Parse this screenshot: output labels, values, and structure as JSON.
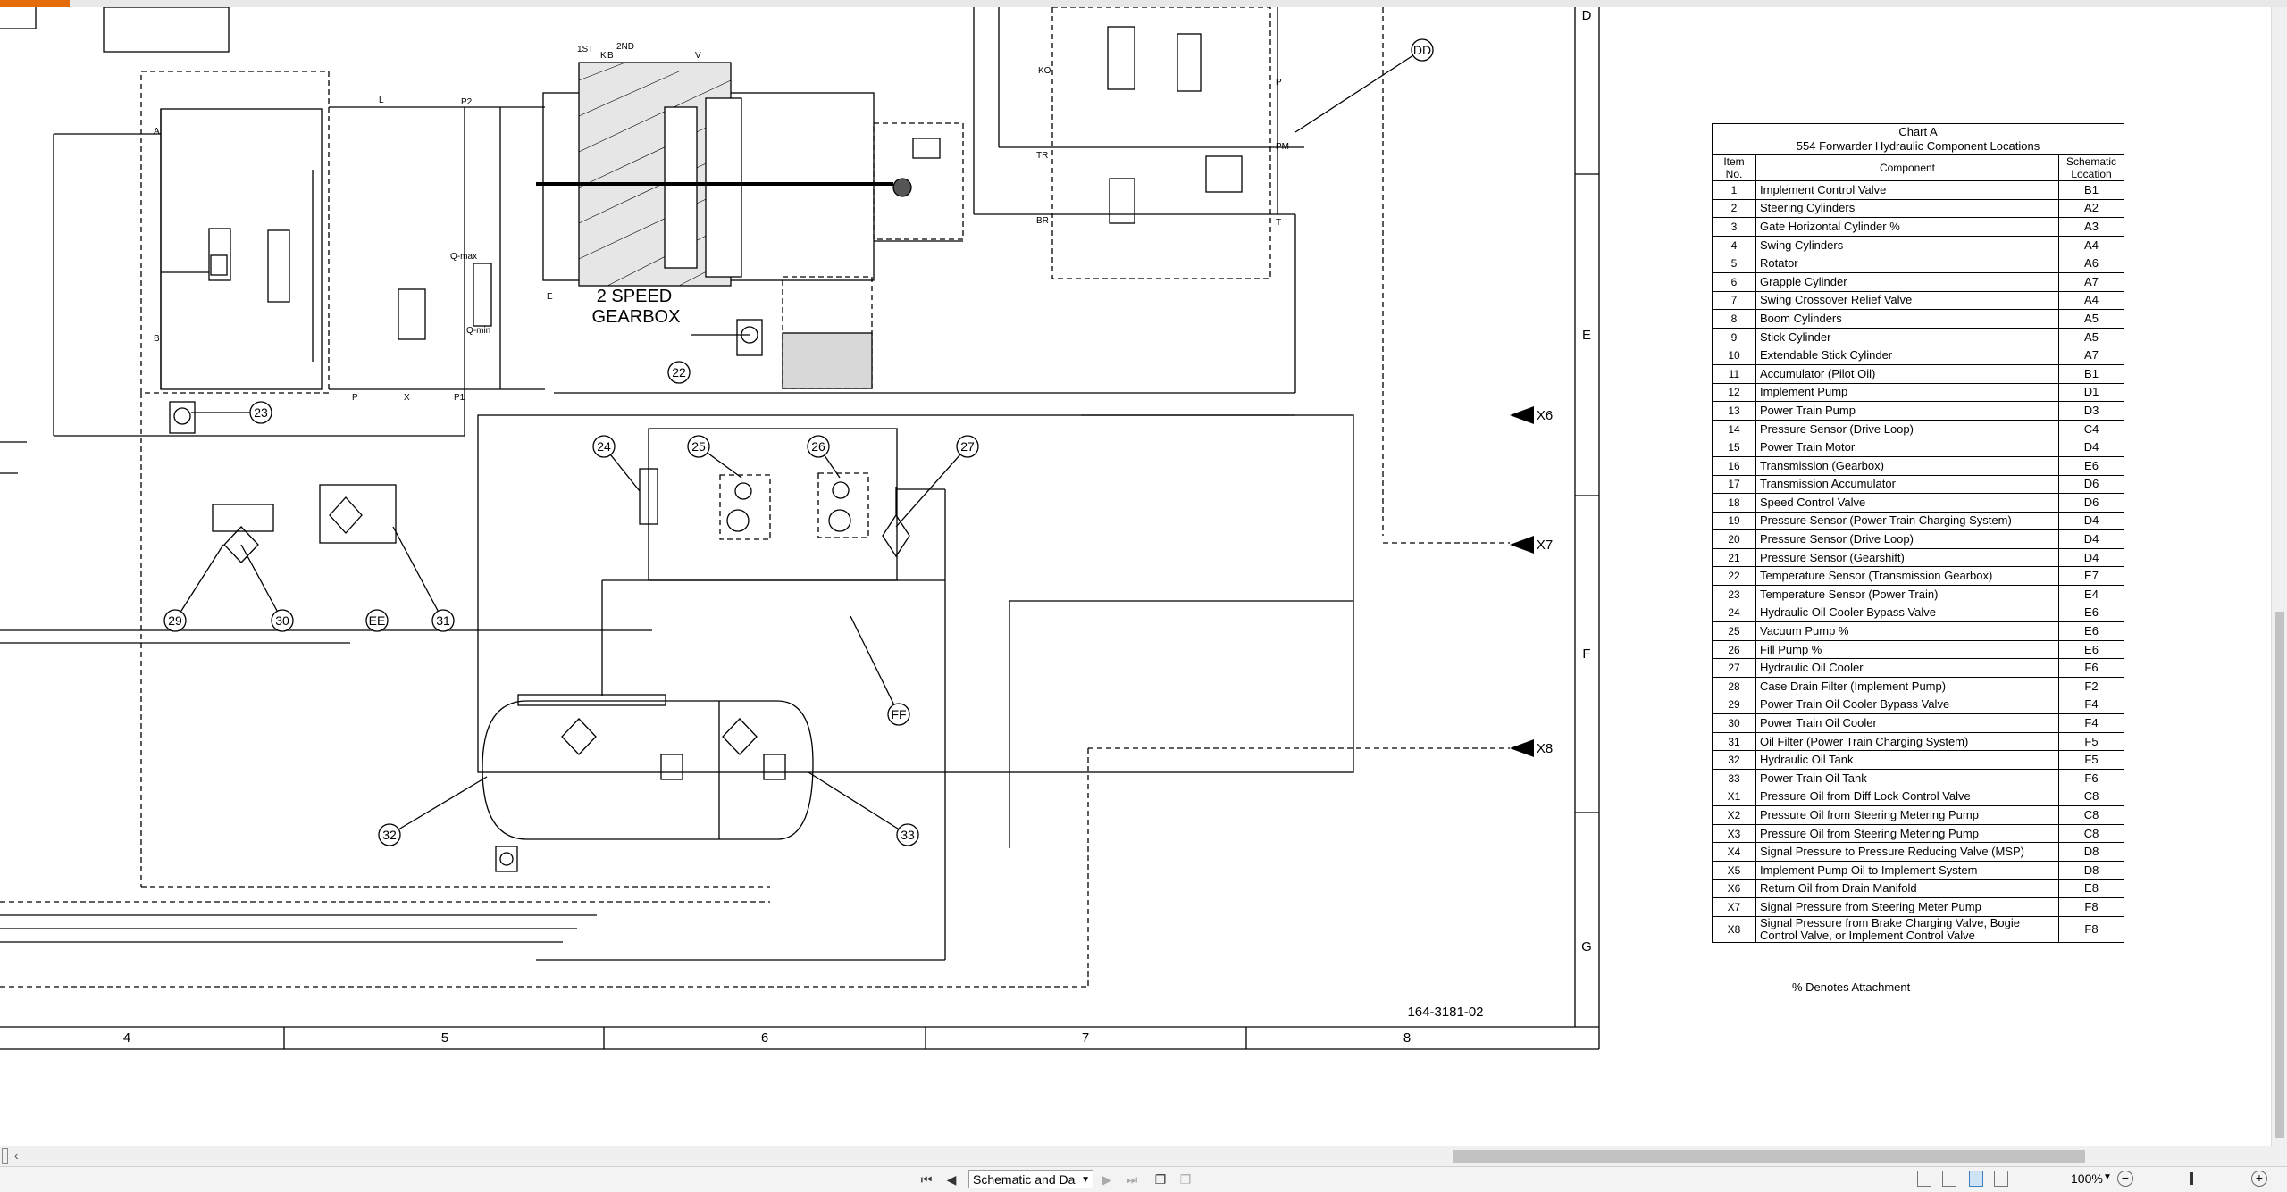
{
  "chart": {
    "title_line1": "Chart A",
    "title_line2": "554 Forwarder Hydraulic Component Locations",
    "headers": {
      "item": "Item No.",
      "component": "Component",
      "location": "Schematic Location"
    },
    "rows": [
      [
        "1",
        "Implement Control Valve",
        "B1"
      ],
      [
        "2",
        "Steering Cylinders",
        "A2"
      ],
      [
        "3",
        "Gate Horizontal Cylinder %",
        "A3"
      ],
      [
        "4",
        "Swing Cylinders",
        "A4"
      ],
      [
        "5",
        "Rotator",
        "A6"
      ],
      [
        "6",
        "Grapple Cylinder",
        "A7"
      ],
      [
        "7",
        "Swing Crossover Relief Valve",
        "A4"
      ],
      [
        "8",
        "Boom Cylinders",
        "A5"
      ],
      [
        "9",
        "Stick Cylinder",
        "A5"
      ],
      [
        "10",
        "Extendable Stick Cylinder",
        "A7"
      ],
      [
        "11",
        "Accumulator (Pilot Oil)",
        "B1"
      ],
      [
        "12",
        "Implement Pump",
        "D1"
      ],
      [
        "13",
        "Power Train Pump",
        "D3"
      ],
      [
        "14",
        "Pressure Sensor (Drive Loop)",
        "C4"
      ],
      [
        "15",
        "Power Train Motor",
        "D4"
      ],
      [
        "16",
        "Transmission (Gearbox)",
        "E6"
      ],
      [
        "17",
        "Transmission Accumulator",
        "D6"
      ],
      [
        "18",
        "Speed Control Valve",
        "D6"
      ],
      [
        "19",
        "Pressure Sensor (Power Train Charging System)",
        "D4"
      ],
      [
        "20",
        "Pressure Sensor (Drive Loop)",
        "D4"
      ],
      [
        "21",
        "Pressure Sensor (Gearshift)",
        "D4"
      ],
      [
        "22",
        "Temperature Sensor (Transmission Gearbox)",
        "E7"
      ],
      [
        "23",
        "Temperature Sensor (Power Train)",
        "E4"
      ],
      [
        "24",
        "Hydraulic Oil Cooler Bypass Valve",
        "E6"
      ],
      [
        "25",
        "Vacuum Pump %",
        "E6"
      ],
      [
        "26",
        "Fill Pump %",
        "E6"
      ],
      [
        "27",
        "Hydraulic Oil Cooler",
        "F6"
      ],
      [
        "28",
        "Case Drain Filter (Implement Pump)",
        "F2"
      ],
      [
        "29",
        "Power Train Oil Cooler Bypass Valve",
        "F4"
      ],
      [
        "30",
        "Power Train Oil Cooler",
        "F4"
      ],
      [
        "31",
        "Oil Filter (Power Train Charging System)",
        "F5"
      ],
      [
        "32",
        "Hydraulic Oil Tank",
        "F5"
      ],
      [
        "33",
        "Power Train Oil Tank",
        "F6"
      ],
      [
        "X1",
        "Pressure Oil from Diff Lock Control Valve",
        "C8"
      ],
      [
        "X2",
        "Pressure Oil from Steering Metering Pump",
        "C8"
      ],
      [
        "X3",
        "Pressure Oil from Steering Metering Pump",
        "C8"
      ],
      [
        "X4",
        "Signal Pressure to Pressure Reducing Valve (MSP)",
        "D8"
      ],
      [
        "X5",
        "Implement Pump Oil to Implement System",
        "D8"
      ],
      [
        "X6",
        "Return Oil from Drain Manifold",
        "E8"
      ],
      [
        "X7",
        "Signal Pressure from Steering Meter Pump",
        "F8"
      ],
      [
        "X8",
        "Signal Pressure from Brake Charging Valve, Bogie Control Valve, or Implement Control Valve",
        "F8"
      ]
    ],
    "footnote": "% Denotes Attachment"
  },
  "schematic": {
    "drawing_number": "164-3181-02",
    "gearbox_label_line1": "2 SPEED",
    "gearbox_label_line2": "GEARBOX",
    "column_labels": [
      "4",
      "5",
      "6",
      "7",
      "8"
    ],
    "row_labels": [
      "D",
      "E",
      "F",
      "G"
    ],
    "callouts": [
      "22",
      "23",
      "24",
      "25",
      "26",
      "27",
      "29",
      "30",
      "EE",
      "31",
      "FF",
      "32",
      "33",
      "DD"
    ],
    "ports": [
      "X6",
      "X7",
      "X8"
    ],
    "small_labels": [
      "1ST",
      "2ND",
      "K",
      "B",
      "V",
      "L",
      "P2",
      "A",
      "B",
      "P",
      "X",
      "P1",
      "E",
      "KO",
      "TR",
      "BR",
      "P",
      "PM",
      "T",
      "Q-max",
      "Q-min"
    ]
  },
  "statusbar": {
    "sheet_name": "Schematic and Da",
    "zoom": "100%"
  },
  "colors": {
    "accent": "#e46c0a",
    "scroll_thumb": "#c2c2c2",
    "toolbar_bg": "#f3f3f3"
  }
}
